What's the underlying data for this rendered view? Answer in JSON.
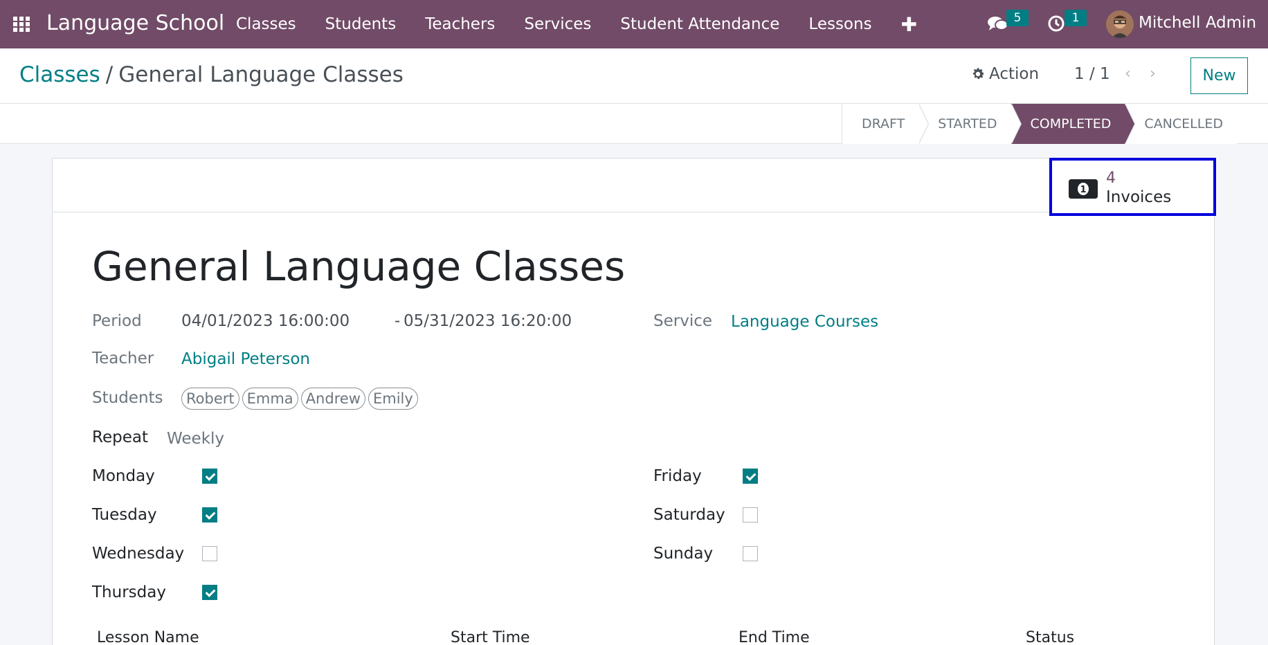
{
  "app": {
    "brand": "Language School",
    "menu": [
      "Classes",
      "Students",
      "Teachers",
      "Services",
      "Student Attendance",
      "Lessons"
    ],
    "plus": "✚",
    "messages_count": "5",
    "activities_count": "1",
    "user_name": "Mitchell Admin"
  },
  "control_panel": {
    "breadcrumb_parent": "Classes",
    "breadcrumb_sep": "/",
    "breadcrumb_current": "General Language Classes",
    "action_label": "Action",
    "pager_value": "1 / 1",
    "pager_prev": "‹",
    "pager_next": "›",
    "new_label": "New"
  },
  "statusbar": {
    "stages": [
      "DRAFT",
      "STARTED",
      "COMPLETED",
      "CANCELLED"
    ],
    "active": "COMPLETED"
  },
  "stat_button": {
    "value": "4",
    "label": "Invoices"
  },
  "record": {
    "title": "General Language Classes",
    "period_label": "Period",
    "period_start": "04/01/2023 16:00:00",
    "period_end": "05/31/2023 16:20:00",
    "period_dash": "-",
    "service_label": "Service",
    "service_value": "Language Courses",
    "teacher_label": "Teacher",
    "teacher_value": "Abigail Peterson",
    "students_label": "Students",
    "students": [
      "Robert",
      "Emma",
      "Andrew",
      "Emily"
    ],
    "repeat_label": "Repeat",
    "repeat_value": "Weekly",
    "days": {
      "monday": {
        "label": "Monday",
        "checked": true
      },
      "tuesday": {
        "label": "Tuesday",
        "checked": true
      },
      "wednesday": {
        "label": "Wednesday",
        "checked": false
      },
      "thursday": {
        "label": "Thursday",
        "checked": true
      },
      "friday": {
        "label": "Friday",
        "checked": true
      },
      "saturday": {
        "label": "Saturday",
        "checked": false
      },
      "sunday": {
        "label": "Sunday",
        "checked": false
      }
    }
  },
  "lessons_table": {
    "columns": [
      "Lesson Name",
      "Start Time",
      "End Time",
      "Status"
    ]
  },
  "colors": {
    "brand": "#714b67",
    "accent": "#017e84",
    "highlight_border": "#0000dd"
  }
}
